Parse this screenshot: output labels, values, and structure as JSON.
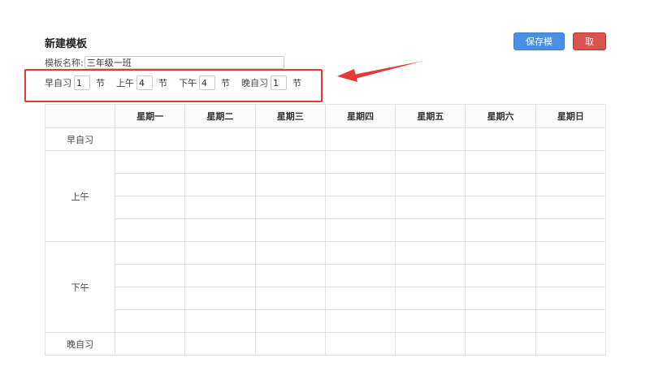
{
  "page": {
    "title": "新建模板"
  },
  "actions": {
    "save_label": "保存模板",
    "cancel_label": "取消",
    "save_color": "#4a90e2",
    "cancel_color": "#d9534f"
  },
  "template_name": {
    "label": "模板名称:",
    "value": "三年级一班"
  },
  "sessions": [
    {
      "label": "早自习",
      "count": "1",
      "unit": "节"
    },
    {
      "label": "上午",
      "count": "4",
      "unit": "节"
    },
    {
      "label": "下午",
      "count": "4",
      "unit": "节"
    },
    {
      "label": "晚自习",
      "count": "1",
      "unit": "节"
    }
  ],
  "annotation": {
    "color": "#e53935"
  },
  "timetable": {
    "days": [
      "星期一",
      "星期二",
      "星期三",
      "星期四",
      "星期五",
      "星期六",
      "星期日"
    ],
    "periods": [
      "早自习",
      "上午",
      "下午",
      "晚自习"
    ]
  }
}
